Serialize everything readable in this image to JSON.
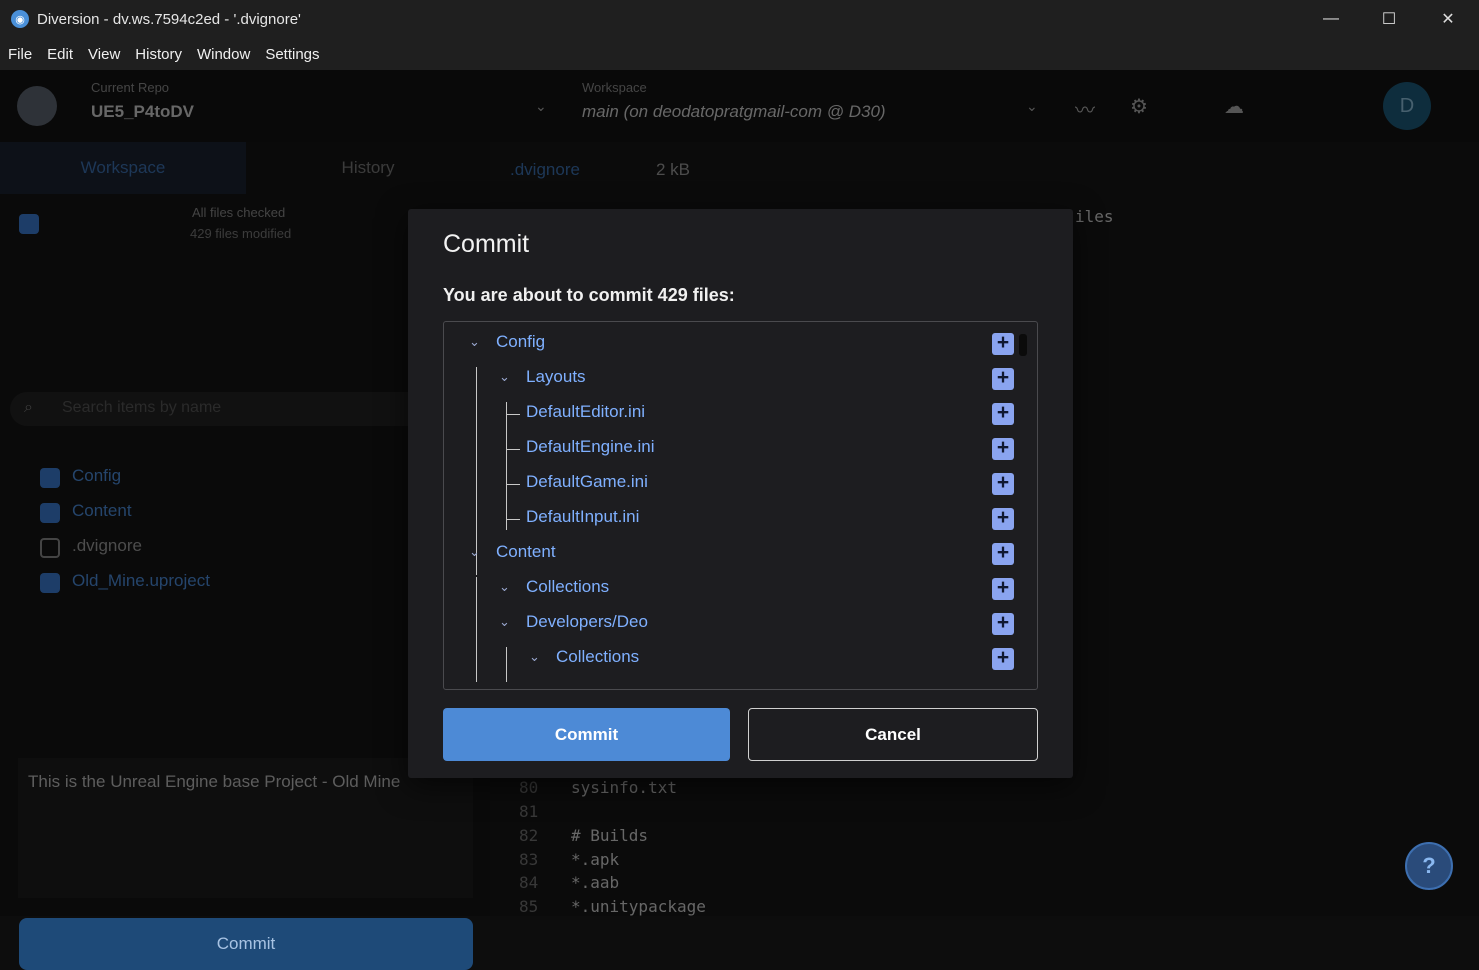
{
  "window": {
    "title": "Diversion - dv.ws.7594c2ed - '.dvignore'",
    "minimize": "—",
    "maximize": "☐",
    "close": "✕"
  },
  "menu": [
    "File",
    "Edit",
    "View",
    "History",
    "Window",
    "Settings"
  ],
  "header": {
    "repo_label": "Current Repo",
    "repo_name": "UE5_P4toDV",
    "workspace_label": "Workspace",
    "workspace_name": "main (on deodatopratgmail-com @ D30)",
    "avatar_initial": "D"
  },
  "left": {
    "tabs": [
      "Workspace",
      "History"
    ],
    "all_checked": "All files checked",
    "modified": "429 files modified",
    "search_placeholder": "Search items by name",
    "items": [
      ".dvignore",
      "Config",
      "Content",
      "Old_Mine.uproject"
    ],
    "description": "This is the Unreal Engine base Project - Old Mine",
    "commit_label": "Commit"
  },
  "editor": {
    "filename": ".dvignore",
    "size": "2 kB",
    "partial": "iles",
    "lines": [
      {
        "n": "80",
        "t": "sysinfo.txt"
      },
      {
        "n": "81",
        "t": ""
      },
      {
        "n": "82",
        "t": "# Builds"
      },
      {
        "n": "83",
        "t": "*.apk"
      },
      {
        "n": "84",
        "t": "*.aab"
      },
      {
        "n": "85",
        "t": "*.unitypackage"
      }
    ]
  },
  "modal": {
    "title": "Commit",
    "subtitle": "You are about to commit 429 files:",
    "tree": [
      {
        "label": "Config",
        "folder": true
      },
      {
        "label": "Layouts",
        "folder": true
      },
      {
        "label": "DefaultEditor.ini",
        "folder": false
      },
      {
        "label": "DefaultEngine.ini",
        "folder": false
      },
      {
        "label": "DefaultGame.ini",
        "folder": false
      },
      {
        "label": "DefaultInput.ini",
        "folder": false
      },
      {
        "label": "Content",
        "folder": true
      },
      {
        "label": "Collections",
        "folder": true
      },
      {
        "label": "Developers/Deo",
        "folder": true
      },
      {
        "label": "Collections",
        "folder": true
      }
    ],
    "commit_button": "Commit",
    "cancel_button": "Cancel"
  },
  "help_icon": "?"
}
